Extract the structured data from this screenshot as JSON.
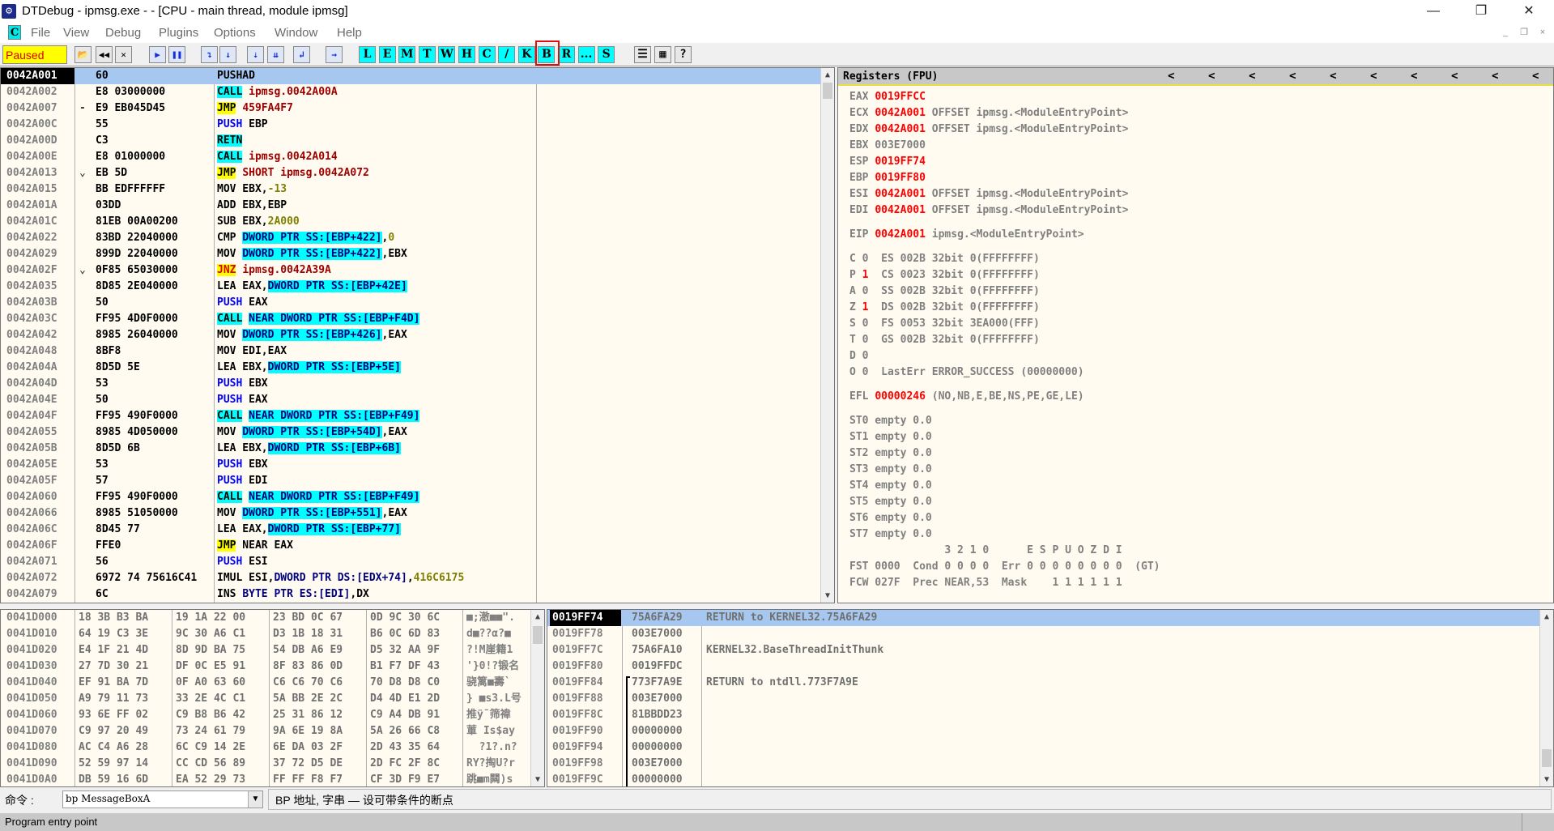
{
  "window": {
    "title": "DTDebug - ipmsg.exe - - [CPU - main thread, module ipmsg]",
    "minimize": "—",
    "restore": "❐",
    "close": "✕"
  },
  "menu": {
    "app_icon": "C",
    "items": [
      "File",
      "View",
      "Debug",
      "Plugins",
      "Options",
      "Window",
      "Help"
    ],
    "mdi": [
      "_",
      "❐",
      "×"
    ]
  },
  "toolbar": {
    "status": "Paused",
    "status_colors": {
      "bg": "#FFFF00",
      "text": "#E00000"
    },
    "icons": [
      {
        "name": "open-icon",
        "glyph": "📂"
      },
      {
        "name": "restart-icon",
        "glyph": "◀◀"
      },
      {
        "name": "close-icon",
        "glyph": "✕"
      },
      {
        "name": "run-icon",
        "glyph": "▶"
      },
      {
        "name": "pause-icon",
        "glyph": "❚❚"
      },
      {
        "name": "step-into-icon",
        "glyph": "↴"
      },
      {
        "name": "step-over-icon",
        "glyph": "↓"
      },
      {
        "name": "trace-into-icon",
        "glyph": "⇣"
      },
      {
        "name": "trace-over-icon",
        "glyph": "⇊"
      },
      {
        "name": "execute-till-return-icon",
        "glyph": "↲"
      },
      {
        "name": "goto-icon",
        "glyph": "→"
      }
    ],
    "letters": [
      "L",
      "E",
      "M",
      "T",
      "W",
      "H",
      "C",
      "/",
      "K",
      "B",
      "R",
      "...",
      "S"
    ],
    "highlighted": "B",
    "tail_icons": [
      {
        "name": "list-icon",
        "glyph": "☰"
      },
      {
        "name": "colors-icon",
        "glyph": "▦"
      },
      {
        "name": "help-icon",
        "glyph": "?"
      }
    ]
  },
  "disasm": {
    "rows": [
      {
        "addr": "0042A001",
        "mark": "",
        "hex": "60",
        "sel": true,
        "code": [
          {
            "t": "PUSHAD"
          }
        ]
      },
      {
        "addr": "0042A002",
        "mark": "",
        "hex": "E8 03000000",
        "code": [
          {
            "t": "CALL",
            "s": "call"
          },
          {
            "t": " "
          },
          {
            "t": "ipmsg.0042A00A",
            "s": "dest"
          }
        ]
      },
      {
        "addr": "0042A007",
        "mark": "-",
        "hex": "E9 EB045D45",
        "code": [
          {
            "t": "JMP",
            "s": "jmp"
          },
          {
            "t": " "
          },
          {
            "t": "459FA4F7",
            "s": "dest"
          }
        ]
      },
      {
        "addr": "0042A00C",
        "mark": "",
        "hex": "55",
        "code": [
          {
            "t": "PUSH",
            "s": "push"
          },
          {
            "t": " EBP"
          }
        ]
      },
      {
        "addr": "0042A00D",
        "mark": "",
        "hex": "C3",
        "code": [
          {
            "t": "RETN",
            "s": "call"
          }
        ]
      },
      {
        "addr": "0042A00E",
        "mark": "",
        "hex": "E8 01000000",
        "code": [
          {
            "t": "CALL",
            "s": "call"
          },
          {
            "t": " "
          },
          {
            "t": "ipmsg.0042A014",
            "s": "dest"
          }
        ]
      },
      {
        "addr": "0042A013",
        "mark": "⌄",
        "hex": "EB 5D",
        "code": [
          {
            "t": "JMP",
            "s": "jmp"
          },
          {
            "t": " "
          },
          {
            "t": "SHORT ipmsg.0042A072",
            "s": "dest"
          }
        ]
      },
      {
        "addr": "0042A015",
        "mark": "",
        "hex": "BB EDFFFFFF",
        "code": [
          {
            "t": "MOV EBX,"
          },
          {
            "t": "-13",
            "s": "num"
          }
        ]
      },
      {
        "addr": "0042A01A",
        "mark": "",
        "hex": "03DD",
        "code": [
          {
            "t": "ADD EBX,EBP"
          }
        ]
      },
      {
        "addr": "0042A01C",
        "mark": "",
        "hex": "81EB 00A00200",
        "code": [
          {
            "t": "SUB EBX,"
          },
          {
            "t": "2A000",
            "s": "num"
          }
        ]
      },
      {
        "addr": "0042A022",
        "mark": "",
        "hex": "83BD 22040000",
        "code": [
          {
            "t": "CMP "
          },
          {
            "t": "DWORD PTR SS:[EBP+422]",
            "s": "mem"
          },
          {
            "t": ","
          },
          {
            "t": "0",
            "s": "num"
          }
        ]
      },
      {
        "addr": "0042A029",
        "mark": "",
        "hex": "899D 22040000",
        "code": [
          {
            "t": "MOV "
          },
          {
            "t": "DWORD PTR SS:[EBP+422]",
            "s": "mem"
          },
          {
            "t": ",EBX"
          }
        ]
      },
      {
        "addr": "0042A02F",
        "mark": "⌄",
        "hex": "0F85 65030000",
        "code": [
          {
            "t": "JNZ",
            "s": "jcc"
          },
          {
            "t": " "
          },
          {
            "t": "ipmsg.0042A39A",
            "s": "dest"
          }
        ]
      },
      {
        "addr": "0042A035",
        "mark": "",
        "hex": "8D85 2E040000",
        "code": [
          {
            "t": "LEA EAX,"
          },
          {
            "t": "DWORD PTR SS:[EBP+42E]",
            "s": "mem"
          }
        ]
      },
      {
        "addr": "0042A03B",
        "mark": "",
        "hex": "50",
        "code": [
          {
            "t": "PUSH",
            "s": "push"
          },
          {
            "t": " EAX"
          }
        ]
      },
      {
        "addr": "0042A03C",
        "mark": "",
        "hex": "FF95 4D0F0000",
        "code": [
          {
            "t": "CALL",
            "s": "call"
          },
          {
            "t": " "
          },
          {
            "t": "NEAR DWORD PTR SS:[EBP+F4D]",
            "s": "mem"
          }
        ]
      },
      {
        "addr": "0042A042",
        "mark": "",
        "hex": "8985 26040000",
        "code": [
          {
            "t": "MOV "
          },
          {
            "t": "DWORD PTR SS:[EBP+426]",
            "s": "mem"
          },
          {
            "t": ",EAX"
          }
        ]
      },
      {
        "addr": "0042A048",
        "mark": "",
        "hex": "8BF8",
        "code": [
          {
            "t": "MOV EDI,EAX"
          }
        ]
      },
      {
        "addr": "0042A04A",
        "mark": "",
        "hex": "8D5D 5E",
        "code": [
          {
            "t": "LEA EBX,"
          },
          {
            "t": "DWORD PTR SS:[EBP+5E]",
            "s": "mem"
          }
        ]
      },
      {
        "addr": "0042A04D",
        "mark": "",
        "hex": "53",
        "code": [
          {
            "t": "PUSH",
            "s": "push"
          },
          {
            "t": " EBX"
          }
        ]
      },
      {
        "addr": "0042A04E",
        "mark": "",
        "hex": "50",
        "code": [
          {
            "t": "PUSH",
            "s": "push"
          },
          {
            "t": " EAX"
          }
        ]
      },
      {
        "addr": "0042A04F",
        "mark": "",
        "hex": "FF95 490F0000",
        "code": [
          {
            "t": "CALL",
            "s": "call"
          },
          {
            "t": " "
          },
          {
            "t": "NEAR DWORD PTR SS:[EBP+F49]",
            "s": "mem"
          }
        ]
      },
      {
        "addr": "0042A055",
        "mark": "",
        "hex": "8985 4D050000",
        "code": [
          {
            "t": "MOV "
          },
          {
            "t": "DWORD PTR SS:[EBP+54D]",
            "s": "mem"
          },
          {
            "t": ",EAX"
          }
        ]
      },
      {
        "addr": "0042A05B",
        "mark": "",
        "hex": "8D5D 6B",
        "code": [
          {
            "t": "LEA EBX,"
          },
          {
            "t": "DWORD PTR SS:[EBP+6B]",
            "s": "mem"
          }
        ]
      },
      {
        "addr": "0042A05E",
        "mark": "",
        "hex": "53",
        "code": [
          {
            "t": "PUSH",
            "s": "push"
          },
          {
            "t": " EBX"
          }
        ]
      },
      {
        "addr": "0042A05F",
        "mark": "",
        "hex": "57",
        "code": [
          {
            "t": "PUSH",
            "s": "push"
          },
          {
            "t": " EDI"
          }
        ]
      },
      {
        "addr": "0042A060",
        "mark": "",
        "hex": "FF95 490F0000",
        "code": [
          {
            "t": "CALL",
            "s": "call"
          },
          {
            "t": " "
          },
          {
            "t": "NEAR DWORD PTR SS:[EBP+F49]",
            "s": "mem"
          }
        ]
      },
      {
        "addr": "0042A066",
        "mark": "",
        "hex": "8985 51050000",
        "code": [
          {
            "t": "MOV "
          },
          {
            "t": "DWORD PTR SS:[EBP+551]",
            "s": "mem"
          },
          {
            "t": ",EAX"
          }
        ]
      },
      {
        "addr": "0042A06C",
        "mark": "",
        "hex": "8D45 77",
        "code": [
          {
            "t": "LEA EAX,"
          },
          {
            "t": "DWORD PTR SS:[EBP+77]",
            "s": "mem"
          }
        ]
      },
      {
        "addr": "0042A06F",
        "mark": "",
        "hex": "FFE0",
        "code": [
          {
            "t": "JMP",
            "s": "jmp"
          },
          {
            "t": " NEAR EAX"
          }
        ]
      },
      {
        "addr": "0042A071",
        "mark": "",
        "hex": "56",
        "code": [
          {
            "t": "PUSH",
            "s": "push"
          },
          {
            "t": " ESI"
          }
        ]
      },
      {
        "addr": "0042A072",
        "mark": "",
        "hex": "6972 74 75616C41",
        "code": [
          {
            "t": "IMUL ESI,"
          },
          {
            "t": "DWORD PTR DS:[EDX+74]",
            "s": "ref"
          },
          {
            "t": ","
          },
          {
            "t": "416C6175",
            "s": "num"
          }
        ]
      },
      {
        "addr": "0042A079",
        "mark": "",
        "hex": "6C",
        "code": [
          {
            "t": "INS "
          },
          {
            "t": "BYTE PTR ES:[EDI]",
            "s": "ref"
          },
          {
            "t": ",DX"
          }
        ]
      }
    ]
  },
  "registers": {
    "title": "Registers (FPU)",
    "nav_arrows": [
      "<",
      "<",
      "<",
      "<",
      "<",
      "<",
      "<",
      "<",
      "<",
      "<"
    ],
    "lines": [
      {
        "segs": [
          {
            "t": "EAX "
          },
          {
            "t": "0019FFCC",
            "s": "red"
          }
        ]
      },
      {
        "segs": [
          {
            "t": "ECX "
          },
          {
            "t": "0042A001",
            "s": "red"
          },
          {
            "t": " OFFSET ipmsg.<ModuleEntryPoint>"
          }
        ]
      },
      {
        "segs": [
          {
            "t": "EDX "
          },
          {
            "t": "0042A001",
            "s": "red"
          },
          {
            "t": " OFFSET ipmsg.<ModuleEntryPoint>"
          }
        ]
      },
      {
        "segs": [
          {
            "t": "EBX 003E7000"
          }
        ]
      },
      {
        "segs": [
          {
            "t": "ESP "
          },
          {
            "t": "0019FF74",
            "s": "red"
          }
        ]
      },
      {
        "segs": [
          {
            "t": "EBP "
          },
          {
            "t": "0019FF80",
            "s": "red"
          }
        ]
      },
      {
        "segs": [
          {
            "t": "ESI "
          },
          {
            "t": "0042A001",
            "s": "red"
          },
          {
            "t": " OFFSET ipmsg.<ModuleEntryPoint>"
          }
        ]
      },
      {
        "segs": [
          {
            "t": "EDI "
          },
          {
            "t": "0042A001",
            "s": "red"
          },
          {
            "t": " OFFSET ipmsg.<ModuleEntryPoint>"
          }
        ]
      },
      {
        "gap": true,
        "segs": [
          {
            "t": "EIP "
          },
          {
            "t": "0042A001",
            "s": "red"
          },
          {
            "t": " ipmsg.<ModuleEntryPoint>"
          }
        ]
      },
      {
        "gap": true,
        "segs": [
          {
            "t": "C 0  ES 002B 32bit 0(FFFFFFFF)"
          }
        ]
      },
      {
        "segs": [
          {
            "t": "P "
          },
          {
            "t": "1",
            "s": "red"
          },
          {
            "t": "  CS 0023 32bit 0(FFFFFFFF)"
          }
        ]
      },
      {
        "segs": [
          {
            "t": "A 0  SS 002B 32bit 0(FFFFFFFF)"
          }
        ]
      },
      {
        "segs": [
          {
            "t": "Z "
          },
          {
            "t": "1",
            "s": "red"
          },
          {
            "t": "  DS 002B 32bit 0(FFFFFFFF)"
          }
        ]
      },
      {
        "segs": [
          {
            "t": "S 0  FS 0053 32bit 3EA000(FFF)"
          }
        ]
      },
      {
        "segs": [
          {
            "t": "T 0  GS 002B 32bit 0(FFFFFFFF)"
          }
        ]
      },
      {
        "segs": [
          {
            "t": "D 0"
          }
        ]
      },
      {
        "segs": [
          {
            "t": "O 0  LastErr ERROR_SUCCESS (00000000)"
          }
        ]
      },
      {
        "gap": true,
        "segs": [
          {
            "t": "EFL "
          },
          {
            "t": "00000246",
            "s": "red"
          },
          {
            "t": " (NO,NB,E,BE,NS,PE,GE,LE)"
          }
        ]
      },
      {
        "gap": true,
        "segs": [
          {
            "t": "ST0 empty 0.0"
          }
        ]
      },
      {
        "segs": [
          {
            "t": "ST1 empty 0.0"
          }
        ]
      },
      {
        "segs": [
          {
            "t": "ST2 empty 0.0"
          }
        ]
      },
      {
        "segs": [
          {
            "t": "ST3 empty 0.0"
          }
        ]
      },
      {
        "segs": [
          {
            "t": "ST4 empty 0.0"
          }
        ]
      },
      {
        "segs": [
          {
            "t": "ST5 empty 0.0"
          }
        ]
      },
      {
        "segs": [
          {
            "t": "ST6 empty 0.0"
          }
        ]
      },
      {
        "segs": [
          {
            "t": "ST7 empty 0.0"
          }
        ]
      },
      {
        "segs": [
          {
            "t": "               3 2 1 0      E S P U O Z D I"
          }
        ]
      },
      {
        "segs": [
          {
            "t": "FST 0000  Cond 0 0 0 0  Err 0 0 0 0 0 0 0 0  (GT)"
          }
        ]
      },
      {
        "segs": [
          {
            "t": "FCW 027F  Prec NEAR,53  Mask    1 1 1 1 1 1"
          }
        ]
      }
    ]
  },
  "dump": {
    "rows": [
      {
        "addr": "0041D000",
        "groups": [
          "18 3B B3 BA",
          "19 1A 22 00",
          "23 BD 0C 67",
          "0D 9C 30 6C"
        ],
        "ascii": "■;澈■■\"."
      },
      {
        "addr": "0041D010",
        "groups": [
          "64 19 C3 3E",
          "9C 30 A6 C1",
          "D3 1B 18 31",
          "B6 0C 6D 83"
        ],
        "ascii": "d■??α?■"
      },
      {
        "addr": "0041D020",
        "groups": [
          "E4 1F 21 4D",
          "8D 9D BA 75",
          "54 DB A6 E9",
          "D5 32 AA 9F"
        ],
        "ascii": "?!M崖籍1"
      },
      {
        "addr": "0041D030",
        "groups": [
          "27 7D 30 21",
          "DF 0C E5 91",
          "8F 83 86 0D",
          "B1 F7 DF 43"
        ],
        "ascii": "'}0!?锻名"
      },
      {
        "addr": "0041D040",
        "groups": [
          "EF 91 BA 7D",
          "0F A0 63 60",
          "C6 C6 70 C6",
          "70 D8 D8 C0"
        ],
        "ascii": "骁篱■壽`"
      },
      {
        "addr": "0041D050",
        "groups": [
          "A9 79 11 73",
          "33 2E 4C C1",
          "5A BB 2E 2C",
          "D4 4D E1 2D"
        ],
        "ascii": "} ■s3.L号"
      },
      {
        "addr": "0041D060",
        "groups": [
          "93 6E FF 02",
          "C9 B8 B6 42",
          "25 31 86 12",
          "C9 A4 DB 91"
        ],
        "ascii": "推ÿ¯筛禕"
      },
      {
        "addr": "0041D070",
        "groups": [
          "C9 97 20 49",
          "73 24 61 79",
          "9A 6E 19 8A",
          "5A 26 66 C8"
        ],
        "ascii": "莗 Is$ay"
      },
      {
        "addr": "0041D080",
        "groups": [
          "AC C4 A6 28",
          "6C C9 14 2E",
          "6E DA 03 2F",
          "2D 43 35 64"
        ],
        "ascii": "  ?1?.n?"
      },
      {
        "addr": "0041D090",
        "groups": [
          "52 59 97 14",
          "CC CD 56 89",
          "37 72 D5 DE",
          "2D FC 2F 8C"
        ],
        "ascii": "RY?掏U?r"
      },
      {
        "addr": "0041D0A0",
        "groups": [
          "DB 59 16 6D",
          "EA 52 29 73",
          "FF FF F8 F7",
          "CF 3D F9 E7"
        ],
        "ascii": "跳■m闗)s"
      }
    ]
  },
  "stack": {
    "rows": [
      {
        "addr": "0019FF74",
        "value": "75A6FA29",
        "comment": "RETURN to KERNEL32.75A6FA29",
        "sel": true
      },
      {
        "addr": "0019FF78",
        "value": "003E7000",
        "comment": ""
      },
      {
        "addr": "0019FF7C",
        "value": "75A6FA10",
        "comment": "KERNEL32.BaseThreadInitThunk"
      },
      {
        "addr": "0019FF80",
        "value": "0019FFDC",
        "comment": ""
      },
      {
        "addr": "0019FF84",
        "value": "773F7A9E",
        "comment": "RETURN to ntdll.773F7A9E"
      },
      {
        "addr": "0019FF88",
        "value": "003E7000",
        "comment": ""
      },
      {
        "addr": "0019FF8C",
        "value": "81BBDD23",
        "comment": ""
      },
      {
        "addr": "0019FF90",
        "value": "00000000",
        "comment": ""
      },
      {
        "addr": "0019FF94",
        "value": "00000000",
        "comment": ""
      },
      {
        "addr": "0019FF98",
        "value": "003E7000",
        "comment": ""
      },
      {
        "addr": "0019FF9C",
        "value": "00000000",
        "comment": ""
      }
    ]
  },
  "command": {
    "label": "命令 :",
    "value": "bp MessageBoxA",
    "hint": "BP 地址, 字串 — 设可带条件的断点"
  },
  "status": {
    "text": "Program entry point"
  },
  "annotation": {
    "color": "#E01010"
  }
}
